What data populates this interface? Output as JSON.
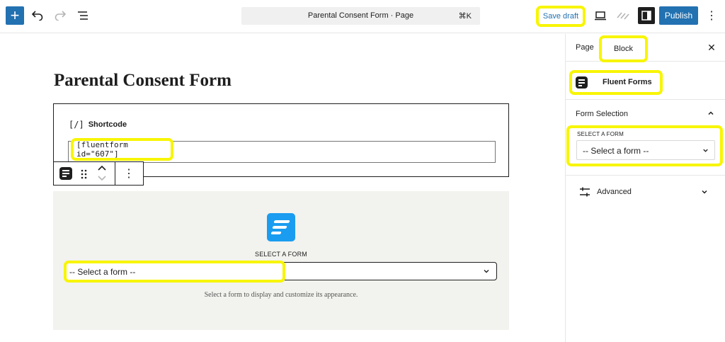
{
  "topbar": {
    "add_label": "+",
    "document_title": "Parental Consent Form · Page",
    "shortcut": "⌘K",
    "save_draft": "Save draft",
    "publish": "Publish",
    "more": "⋮"
  },
  "editor": {
    "page_title": "Parental Consent Form",
    "shortcode_block": {
      "icon_glyph": "[/]",
      "label": "Shortcode",
      "value": "[fluentform id=\"607\"]"
    },
    "block_toolbar": {
      "more": "⋮"
    },
    "fluent_block": {
      "select_label": "SELECT A FORM",
      "select_value": "-- Select a form --",
      "help_text": "Select a form to display and customize its appearance."
    }
  },
  "sidebar": {
    "tabs": [
      {
        "label": "Page"
      },
      {
        "label": "Block",
        "active": true
      }
    ],
    "close": "✕",
    "block_card": {
      "title": "Fluent Forms"
    },
    "form_selection": {
      "title": "Form Selection",
      "select_label": "SELECT A FORM",
      "select_value": "-- Select a form --"
    },
    "advanced": {
      "title": "Advanced"
    }
  },
  "colors": {
    "accent": "#2271b1",
    "highlight": "#f8f500",
    "fluent_blue": "#1a9cf0",
    "block_bg": "#f2f2ee"
  },
  "icons": [
    "add-icon",
    "undo-icon",
    "redo-icon",
    "document-overview-icon",
    "preview-icon",
    "jetpack-icon",
    "settings-sidebar-icon",
    "more-vertical-icon",
    "fluent-forms-icon",
    "drag-handle-icon",
    "move-up-icon",
    "move-down-icon",
    "close-icon",
    "chevron-up-icon",
    "chevron-down-icon",
    "sliders-icon"
  ]
}
